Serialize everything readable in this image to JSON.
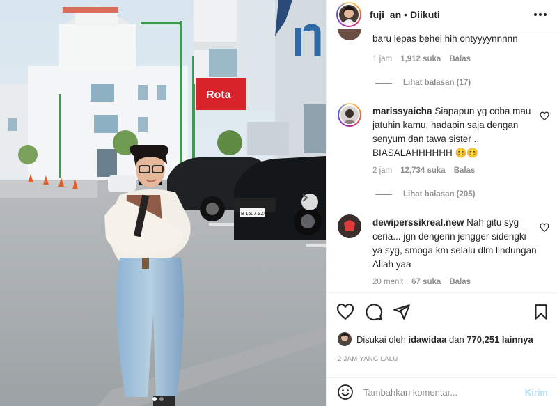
{
  "header": {
    "username": "fuji_an",
    "separator": "•",
    "follow_status": "Diikuti"
  },
  "comments": [
    {
      "partial_text": "baru lepas behel hih ontyyyynnnnn",
      "time": "1 jam",
      "likes": "1,912 suka",
      "reply": "Balas",
      "view_replies": "Lihat balasan (17)"
    },
    {
      "user": "marissyaicha",
      "text": "Siapapun yg coba mau jatuhin kamu, hadapin saja dengan senyum dan tawa sister .. BIASALAHHHHHH 😊😊",
      "time": "2 jam",
      "likes": "12,734 suka",
      "reply": "Balas",
      "view_replies": "Lihat balasan (205)"
    },
    {
      "user": "dewiperssikreal.new",
      "text": "Nah gitu syg ceria... jgn dengerin jengger sidengki ya syg, smoga km selalu dlm lindungan Allah yaa",
      "time": "20 menit",
      "likes": "67 suka",
      "reply": "Balas"
    }
  ],
  "likes_line": {
    "prefix": "Disukai oleh",
    "user": "idawidaa",
    "conj": "dan",
    "count": "770,251 lainnya"
  },
  "post_time": "2 JAM YANG LALU",
  "add_comment": {
    "placeholder": "Tambahkan komentar...",
    "post_label": "Kirim"
  },
  "icons": {
    "like": "heart-icon",
    "comment": "comment-icon",
    "share": "send-icon",
    "save": "bookmark-icon",
    "more": "more-dots-icon",
    "emoji": "emoji-icon",
    "next": "chevron-right-icon"
  },
  "colors": {
    "text": "#262626",
    "muted": "#8e8e8e",
    "post_button_disabled": "#b2dffc",
    "border": "#efefef"
  },
  "photo": {
    "sign_text": "Rota",
    "car_plate": "B 1607 SZU"
  },
  "carousel": {
    "count": 2,
    "active": 1
  }
}
